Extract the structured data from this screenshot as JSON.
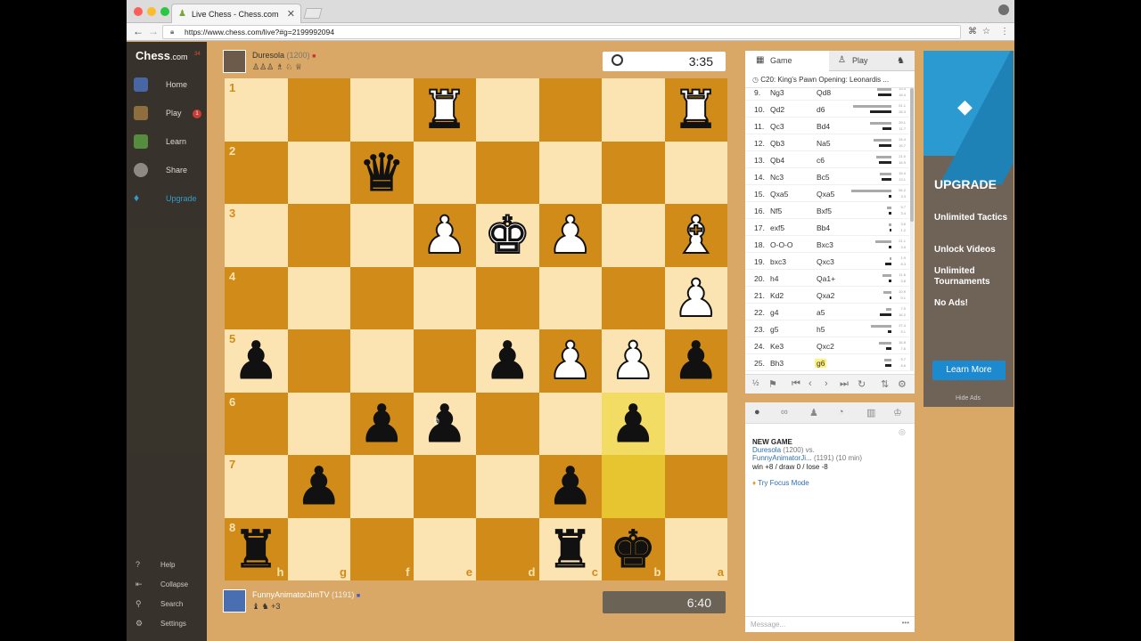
{
  "browser": {
    "tab_title": "Live Chess - Chess.com",
    "url": "https://www.chess.com/live?#g=2199992094",
    "secure_label": "Secure"
  },
  "nav": {
    "logo": "Chess",
    "logo_suffix": ".com",
    "logo_badge": "34",
    "items": [
      {
        "label": "Home"
      },
      {
        "label": "Play",
        "badge": "1"
      },
      {
        "label": "Learn"
      },
      {
        "label": "Share"
      },
      {
        "label": "Upgrade"
      }
    ],
    "bottom": [
      {
        "label": "Help"
      },
      {
        "label": "Collapse"
      },
      {
        "label": "Search"
      },
      {
        "label": "Settings"
      }
    ]
  },
  "player_top": {
    "name": "Duresola",
    "rating": "(1200)",
    "captured": "♙♙♙ ♗ ♘ ♕"
  },
  "player_bottom": {
    "name": "FunnyAnimatorJimTV",
    "rating": "(1191)",
    "captured": "♝ ♞ +3"
  },
  "clock_top": "3:35",
  "clock_bottom": "6:40",
  "board": {
    "ranks": [
      "1",
      "2",
      "3",
      "4",
      "5",
      "6",
      "7",
      "8"
    ],
    "files": [
      "h",
      "g",
      "f",
      "e",
      "d",
      "c",
      "b",
      "a"
    ],
    "pieces": [
      {
        "sq": "a1",
        "glyph": "♜",
        "color": "w"
      },
      {
        "sq": "e1",
        "glyph": "♜",
        "color": "w"
      },
      {
        "sq": "f2",
        "glyph": "♛",
        "color": "b"
      },
      {
        "sq": "a3",
        "glyph": "♝",
        "color": "w"
      },
      {
        "sq": "c3",
        "glyph": "♟",
        "color": "w"
      },
      {
        "sq": "d3",
        "glyph": "♚",
        "color": "w"
      },
      {
        "sq": "e3",
        "glyph": "♟",
        "color": "w"
      },
      {
        "sq": "a4",
        "glyph": "♟",
        "color": "w"
      },
      {
        "sq": "a5",
        "glyph": "♟",
        "color": "b"
      },
      {
        "sq": "b5",
        "glyph": "♟",
        "color": "w"
      },
      {
        "sq": "c5",
        "glyph": "♟",
        "color": "w"
      },
      {
        "sq": "d5",
        "glyph": "♟",
        "color": "b"
      },
      {
        "sq": "h5",
        "glyph": "♟",
        "color": "b"
      },
      {
        "sq": "b6",
        "glyph": "♟",
        "color": "b"
      },
      {
        "sq": "e6",
        "glyph": "♟",
        "color": "b"
      },
      {
        "sq": "f6",
        "glyph": "♟",
        "color": "b"
      },
      {
        "sq": "c7",
        "glyph": "♟",
        "color": "b"
      },
      {
        "sq": "g7",
        "glyph": "♟",
        "color": "b"
      },
      {
        "sq": "b8",
        "glyph": "♚",
        "color": "b"
      },
      {
        "sq": "c8",
        "glyph": "♜",
        "color": "b"
      },
      {
        "sq": "h8",
        "glyph": "♜",
        "color": "b"
      }
    ],
    "highlights": [
      "b6",
      "b7"
    ]
  },
  "right_panel": {
    "tabs": [
      "Game",
      "Play"
    ],
    "opening": "C20: King's Pawn Opening: Leonardis ...",
    "moves": [
      {
        "n": "9.",
        "w": "Ng3",
        "b": "Qd8",
        "t": [
          "19.4",
          "18.4"
        ]
      },
      {
        "n": "10.",
        "w": "Qd2",
        "b": "d6",
        "t": [
          "51.1",
          "28.3"
        ]
      },
      {
        "n": "11.",
        "w": "Qc3",
        "b": "Bd4",
        "t": [
          "29.1",
          "11.7"
        ]
      },
      {
        "n": "12.",
        "w": "Qb3",
        "b": "Na5",
        "t": [
          "24.4",
          "16.7"
        ]
      },
      {
        "n": "13.",
        "w": "Qb4",
        "b": "c6",
        "t": [
          "21.0",
          "16.9"
        ]
      },
      {
        "n": "14.",
        "w": "Nc3",
        "b": "Bc5",
        "t": [
          "15.4",
          "13.1"
        ]
      },
      {
        "n": "15.",
        "w": "Qxa5",
        "b": "Qxa5",
        "t": [
          "54.2",
          "3.3"
        ]
      },
      {
        "n": "16.",
        "w": "Nf5",
        "b": "Bxf5",
        "t": [
          "5.7",
          "3.4"
        ]
      },
      {
        "n": "17.",
        "w": "exf5",
        "b": "Bb4",
        "t": [
          "3.6",
          "1.2"
        ]
      },
      {
        "n": "18.",
        "w": "O-O-O",
        "b": "Bxc3",
        "t": [
          "21.1",
          "3.5"
        ]
      },
      {
        "n": "19.",
        "w": "bxc3",
        "b": "Qxc3",
        "t": [
          "1.9",
          "8.3"
        ]
      },
      {
        "n": "20.",
        "w": "h4",
        "b": "Qa1+",
        "t": [
          "11.6",
          "3.8"
        ]
      },
      {
        "n": "21.",
        "w": "Kd2",
        "b": "Qxa2",
        "t": [
          "10.9",
          "0.1"
        ]
      },
      {
        "n": "22.",
        "w": "g4",
        "b": "a5",
        "t": [
          "7.0",
          "16.2"
        ]
      },
      {
        "n": "23.",
        "w": "g5",
        "b": "h5",
        "t": [
          "27.4",
          "5.1"
        ]
      },
      {
        "n": "24.",
        "w": "Ke3",
        "b": "Qxc2",
        "t": [
          "16.8",
          "7.6"
        ]
      },
      {
        "n": "25.",
        "w": "Bh3",
        "b": "g6",
        "t": [
          "9.7",
          "8.6"
        ],
        "current": true
      }
    ]
  },
  "chat": {
    "title": "NEW GAME",
    "white": "Duresola",
    "white_rating": "(1200) vs.",
    "black": "FunnyAnimatorJi...",
    "black_info": "(1191) (10 min)",
    "stakes": "win +8 / draw 0 / lose -8",
    "focus": "Try Focus Mode",
    "placeholder": "Message..."
  },
  "ad": {
    "title": "UPGRADE",
    "features": [
      "Unlimited Tactics",
      "Unlock Videos",
      "Unlimited Tournaments",
      "No Ads!"
    ],
    "button": "Learn More",
    "hide": "Hide Ads"
  },
  "colors": {
    "light_square": "#fce4b2",
    "dark_square": "#d08b18",
    "highlight": "#f3dc64",
    "ad_blue": "#2a9ad1"
  }
}
